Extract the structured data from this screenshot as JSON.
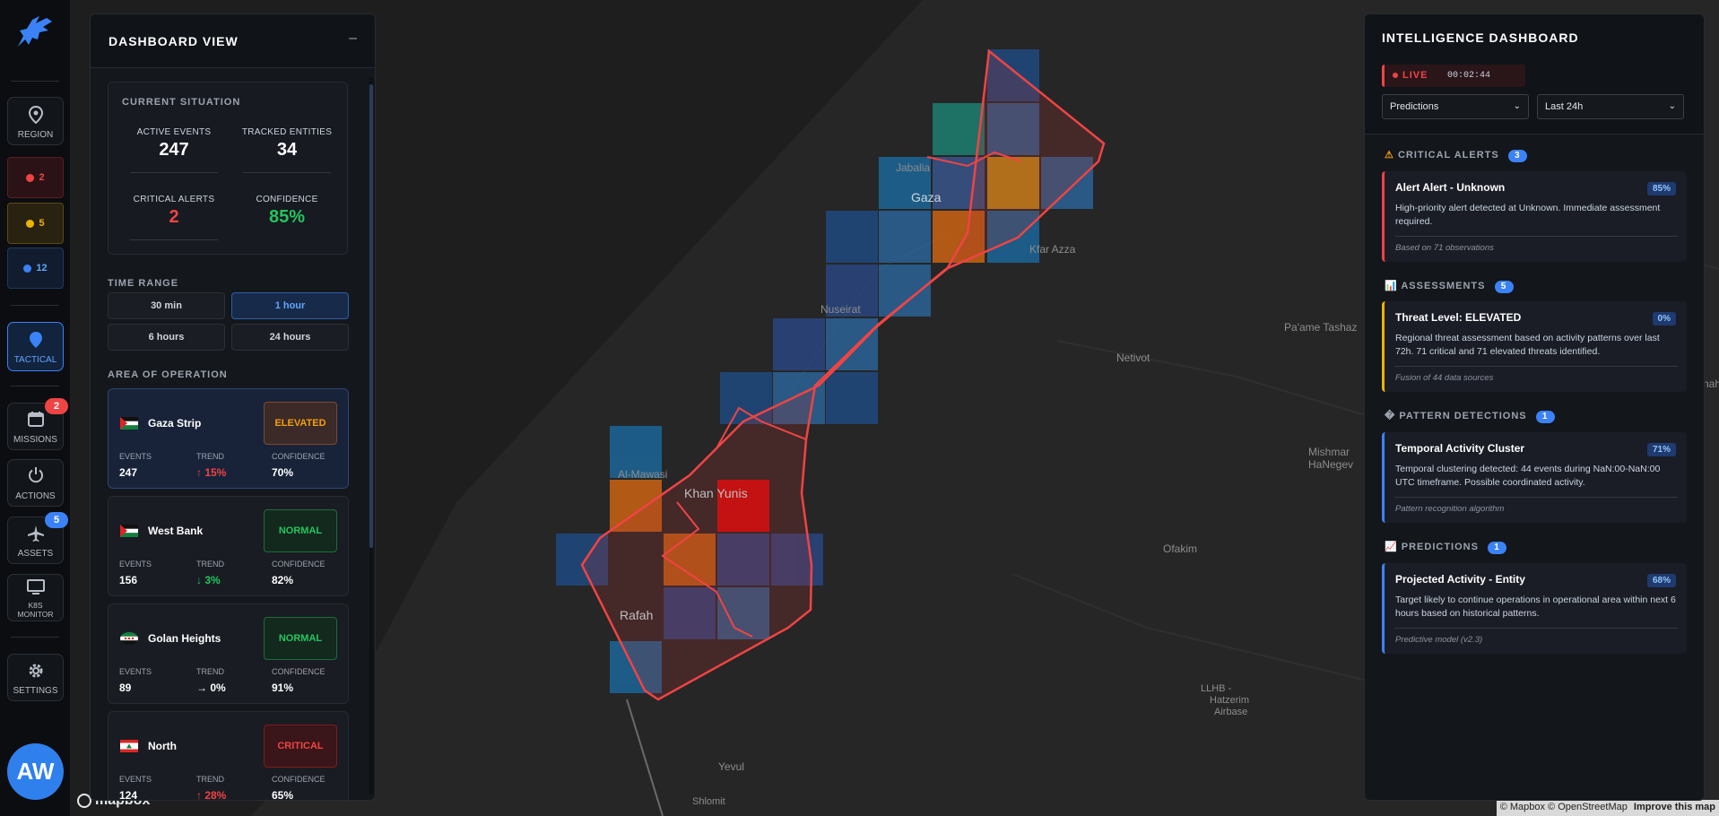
{
  "sidebar": {
    "region_label": "REGION",
    "counters": [
      {
        "value": "2",
        "color": "#ef4444"
      },
      {
        "value": "5",
        "color": "#eab308"
      },
      {
        "value": "12",
        "color": "#3b82f6"
      }
    ],
    "tactical_label": "TACTICAL",
    "missions_label": "MISSIONS",
    "missions_badge": "2",
    "actions_label": "ACTIONS",
    "assets_label": "ASSETS",
    "assets_badge": "5",
    "k8s_label_1": "K8S",
    "k8s_label_2": "MONITOR",
    "settings_label": "SETTINGS",
    "avatar_initials": "AW"
  },
  "dashboard": {
    "title": "DASHBOARD VIEW",
    "minimize": "–",
    "situation": {
      "title": "CURRENT SITUATION",
      "active_events_label": "ACTIVE EVENTS",
      "active_events": "247",
      "tracked_entities_label": "TRACKED ENTITIES",
      "tracked_entities": "34",
      "critical_alerts_label": "CRITICAL ALERTS",
      "critical_alerts": "2",
      "confidence_label": "CONFIDENCE",
      "confidence": "85%"
    },
    "time_range": {
      "title": "TIME RANGE",
      "options": [
        "30 min",
        "1 hour",
        "6 hours",
        "24 hours"
      ],
      "selected": "1 hour"
    },
    "area_of_operation": {
      "title": "AREA OF OPERATION",
      "metric_labels": {
        "events": "EVENTS",
        "trend": "TREND",
        "confidence": "CONFIDENCE"
      },
      "areas": [
        {
          "name": "Gaza Strip",
          "status": "ELEVATED",
          "events": "247",
          "trend": "↑ 15%",
          "confidence": "70%"
        },
        {
          "name": "West Bank",
          "status": "NORMAL",
          "events": "156",
          "trend": "↓ 3%",
          "confidence": "82%"
        },
        {
          "name": "Golan Heights",
          "status": "NORMAL",
          "events": "89",
          "trend": "→ 0%",
          "confidence": "91%"
        },
        {
          "name": "North",
          "status": "CRITICAL",
          "events": "124",
          "trend": "↑ 28%",
          "confidence": "65%"
        }
      ]
    }
  },
  "intel": {
    "title": "INTELLIGENCE DASHBOARD",
    "live_label": "LIVE",
    "timer": "00:02:44",
    "filter_type": "Predictions",
    "filter_time": "Last 24h",
    "sections": [
      {
        "title": "CRITICAL ALERTS",
        "count": "3",
        "icon": "⚠",
        "card": {
          "title": "Alert Alert - Unknown",
          "percent": "85%",
          "desc": "High-priority alert detected at Unknown. Immediate assessment required.",
          "footer": "Based on 71 observations",
          "color": "#ef4444"
        }
      },
      {
        "title": "ASSESSMENTS",
        "count": "5",
        "icon": "📊",
        "card": {
          "title": "Threat Level: ELEVATED",
          "percent": "0%",
          "desc": "Regional threat assessment based on activity patterns over last 72h. 71 critical and 71 elevated threats identified.",
          "footer": "Fusion of 44 data sources",
          "color": "#eab308"
        }
      },
      {
        "title": "PATTERN DETECTIONS",
        "count": "1",
        "icon": "�",
        "card": {
          "title": "Temporal Activity Cluster",
          "percent": "71%",
          "desc": "Temporal clustering detected: 44 events during NaN:00-NaN:00 UTC timeframe. Possible coordinated activity.",
          "footer": "Pattern recognition algorithm",
          "color": "#3b82f6"
        }
      },
      {
        "title": "PREDICTIONS",
        "count": "1",
        "icon": "📈",
        "card": {
          "title": "Projected Activity - Entity",
          "percent": "68%",
          "desc": "Target likely to continue operations in operational area within next 6 hours based on historical patterns.",
          "footer": "Predictive model (v2.3)",
          "color": "#3b82f6"
        }
      }
    ]
  },
  "map": {
    "labels": {
      "gaza": "Gaza",
      "jabalia": "Jabalia",
      "kfar_azza": "Kfar Azza",
      "nuseirat": "Nuseirat",
      "paame": "Pa'ame Tashaz",
      "netivot": "Netivot",
      "mishmar_1": "Mishmar",
      "mishmar_2": "HaNegev",
      "al_mawasi": "Al-Mawasi",
      "khan_yunis": "Khan Yunis",
      "ofakim": "Ofakim",
      "rafah": "Rafah",
      "llhb_1": "LLHB -",
      "llhb_2": "Hatzerim",
      "llhb_3": "Airbase",
      "yevul": "Yevul",
      "shlomit": "Shlomit",
      "nahal": "nah"
    },
    "logo_text": "mapbox",
    "attribution": "© Mapbox © OpenStreetMap",
    "improve": "Improve this map"
  }
}
